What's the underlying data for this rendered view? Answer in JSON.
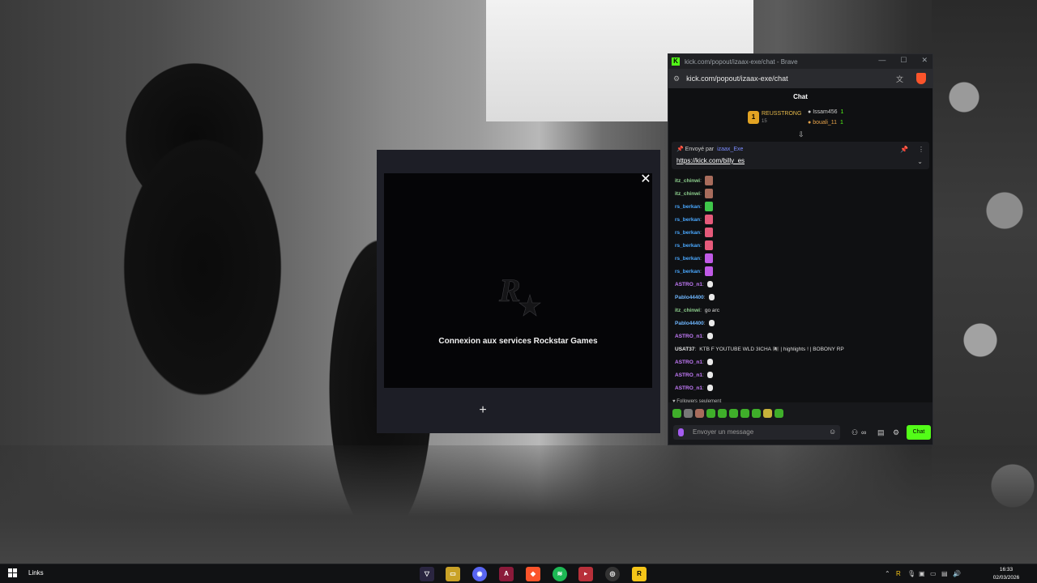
{
  "browser": {
    "title": "kick.com/popout/izaax-exe/chat - Brave",
    "url": "kick.com/popout/izaax-exe/chat"
  },
  "chat": {
    "header": "Chat",
    "leaderboard": {
      "first": {
        "rank": "1",
        "name": "REUSSTRONG",
        "sub": "15"
      },
      "second": {
        "name": "Issam456",
        "value": "1"
      },
      "third": {
        "name": "bouali_11",
        "value": "1"
      }
    },
    "pinned": {
      "label": "Envoyé par",
      "user": "izaax_Exe",
      "link": "https://kick.com/billy_es"
    },
    "messages": [
      {
        "user": "itz_chinwi",
        "color": "#8fd18f",
        "text": "",
        "emote": "#a86c5c"
      },
      {
        "user": "itz_chinwi",
        "color": "#8fd18f",
        "text": "",
        "emote": "#a86c5c"
      },
      {
        "user": "rs_berkan",
        "color": "#4aa8ff",
        "text": "",
        "emote": "#3fc64a"
      },
      {
        "user": "rs_berkan",
        "color": "#4aa8ff",
        "text": "",
        "emote": "#e65a7a"
      },
      {
        "user": "rs_berkan",
        "color": "#4aa8ff",
        "text": "",
        "emote": "#e65a7a"
      },
      {
        "user": "rs_berkan",
        "color": "#4aa8ff",
        "text": "",
        "emote": "#e65a7a"
      },
      {
        "user": "rs_berkan",
        "color": "#4aa8ff",
        "text": "",
        "emote": "#c05ae6"
      },
      {
        "user": "rs_berkan",
        "color": "#4aa8ff",
        "text": "",
        "emote": "#c05ae6"
      },
      {
        "user": "ASTRO_n1",
        "color": "#c77dff",
        "text": "",
        "emote": "small"
      },
      {
        "user": "Pablo44400",
        "color": "#6fb7ff",
        "text": "",
        "emote": "small"
      },
      {
        "user": "itz_chinwi",
        "color": "#8fd18f",
        "text": "go arc",
        "emote": ""
      },
      {
        "user": "Pablo44400",
        "color": "#6fb7ff",
        "text": "",
        "emote": "small"
      },
      {
        "user": "ASTRO_n1",
        "color": "#c77dff",
        "text": "",
        "emote": "small"
      },
      {
        "user": "USAT37",
        "color": "#e6e6e6",
        "text": "KTB F YOUTUBE WLD 3ICHA 🏴‍☠️ | highlights ! | BOBONY RP",
        "emote": ""
      },
      {
        "user": "ASTRO_n1",
        "color": "#c77dff",
        "text": "",
        "emote": "small"
      },
      {
        "user": "ASTRO_n1",
        "color": "#c77dff",
        "text": "",
        "emote": "small"
      },
      {
        "user": "ASTRO_n1",
        "color": "#c77dff",
        "text": "",
        "emote": "small"
      }
    ],
    "followers_only": "Followers seulement",
    "input_placeholder": "Envoyer un message",
    "send_label": "Chat"
  },
  "rockstar": {
    "title": "Connexion aux services Rockstar Games",
    "close": "✕",
    "add": "+"
  },
  "taskbar": {
    "links": "Links",
    "time": "16:33",
    "date": "02/03/2026"
  },
  "colors": {
    "kick_green": "#53fc18",
    "brave_orange": "#fb542b"
  }
}
